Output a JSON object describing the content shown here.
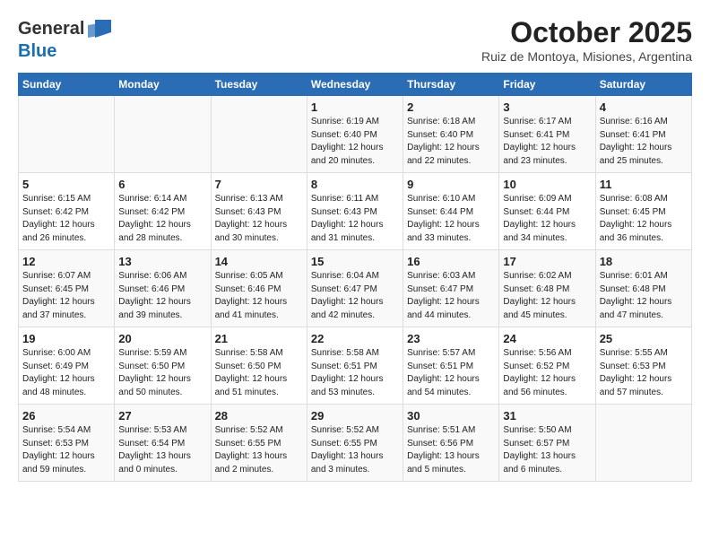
{
  "header": {
    "logo_line1": "General",
    "logo_line2": "Blue",
    "title": "October 2025",
    "subtitle": "Ruiz de Montoya, Misiones, Argentina"
  },
  "days_of_week": [
    "Sunday",
    "Monday",
    "Tuesday",
    "Wednesday",
    "Thursday",
    "Friday",
    "Saturday"
  ],
  "weeks": [
    [
      {
        "day": "",
        "info": ""
      },
      {
        "day": "",
        "info": ""
      },
      {
        "day": "",
        "info": ""
      },
      {
        "day": "1",
        "info": "Sunrise: 6:19 AM\nSunset: 6:40 PM\nDaylight: 12 hours and 20 minutes."
      },
      {
        "day": "2",
        "info": "Sunrise: 6:18 AM\nSunset: 6:40 PM\nDaylight: 12 hours and 22 minutes."
      },
      {
        "day": "3",
        "info": "Sunrise: 6:17 AM\nSunset: 6:41 PM\nDaylight: 12 hours and 23 minutes."
      },
      {
        "day": "4",
        "info": "Sunrise: 6:16 AM\nSunset: 6:41 PM\nDaylight: 12 hours and 25 minutes."
      }
    ],
    [
      {
        "day": "5",
        "info": "Sunrise: 6:15 AM\nSunset: 6:42 PM\nDaylight: 12 hours and 26 minutes."
      },
      {
        "day": "6",
        "info": "Sunrise: 6:14 AM\nSunset: 6:42 PM\nDaylight: 12 hours and 28 minutes."
      },
      {
        "day": "7",
        "info": "Sunrise: 6:13 AM\nSunset: 6:43 PM\nDaylight: 12 hours and 30 minutes."
      },
      {
        "day": "8",
        "info": "Sunrise: 6:11 AM\nSunset: 6:43 PM\nDaylight: 12 hours and 31 minutes."
      },
      {
        "day": "9",
        "info": "Sunrise: 6:10 AM\nSunset: 6:44 PM\nDaylight: 12 hours and 33 minutes."
      },
      {
        "day": "10",
        "info": "Sunrise: 6:09 AM\nSunset: 6:44 PM\nDaylight: 12 hours and 34 minutes."
      },
      {
        "day": "11",
        "info": "Sunrise: 6:08 AM\nSunset: 6:45 PM\nDaylight: 12 hours and 36 minutes."
      }
    ],
    [
      {
        "day": "12",
        "info": "Sunrise: 6:07 AM\nSunset: 6:45 PM\nDaylight: 12 hours and 37 minutes."
      },
      {
        "day": "13",
        "info": "Sunrise: 6:06 AM\nSunset: 6:46 PM\nDaylight: 12 hours and 39 minutes."
      },
      {
        "day": "14",
        "info": "Sunrise: 6:05 AM\nSunset: 6:46 PM\nDaylight: 12 hours and 41 minutes."
      },
      {
        "day": "15",
        "info": "Sunrise: 6:04 AM\nSunset: 6:47 PM\nDaylight: 12 hours and 42 minutes."
      },
      {
        "day": "16",
        "info": "Sunrise: 6:03 AM\nSunset: 6:47 PM\nDaylight: 12 hours and 44 minutes."
      },
      {
        "day": "17",
        "info": "Sunrise: 6:02 AM\nSunset: 6:48 PM\nDaylight: 12 hours and 45 minutes."
      },
      {
        "day": "18",
        "info": "Sunrise: 6:01 AM\nSunset: 6:48 PM\nDaylight: 12 hours and 47 minutes."
      }
    ],
    [
      {
        "day": "19",
        "info": "Sunrise: 6:00 AM\nSunset: 6:49 PM\nDaylight: 12 hours and 48 minutes."
      },
      {
        "day": "20",
        "info": "Sunrise: 5:59 AM\nSunset: 6:50 PM\nDaylight: 12 hours and 50 minutes."
      },
      {
        "day": "21",
        "info": "Sunrise: 5:58 AM\nSunset: 6:50 PM\nDaylight: 12 hours and 51 minutes."
      },
      {
        "day": "22",
        "info": "Sunrise: 5:58 AM\nSunset: 6:51 PM\nDaylight: 12 hours and 53 minutes."
      },
      {
        "day": "23",
        "info": "Sunrise: 5:57 AM\nSunset: 6:51 PM\nDaylight: 12 hours and 54 minutes."
      },
      {
        "day": "24",
        "info": "Sunrise: 5:56 AM\nSunset: 6:52 PM\nDaylight: 12 hours and 56 minutes."
      },
      {
        "day": "25",
        "info": "Sunrise: 5:55 AM\nSunset: 6:53 PM\nDaylight: 12 hours and 57 minutes."
      }
    ],
    [
      {
        "day": "26",
        "info": "Sunrise: 5:54 AM\nSunset: 6:53 PM\nDaylight: 12 hours and 59 minutes."
      },
      {
        "day": "27",
        "info": "Sunrise: 5:53 AM\nSunset: 6:54 PM\nDaylight: 13 hours and 0 minutes."
      },
      {
        "day": "28",
        "info": "Sunrise: 5:52 AM\nSunset: 6:55 PM\nDaylight: 13 hours and 2 minutes."
      },
      {
        "day": "29",
        "info": "Sunrise: 5:52 AM\nSunset: 6:55 PM\nDaylight: 13 hours and 3 minutes."
      },
      {
        "day": "30",
        "info": "Sunrise: 5:51 AM\nSunset: 6:56 PM\nDaylight: 13 hours and 5 minutes."
      },
      {
        "day": "31",
        "info": "Sunrise: 5:50 AM\nSunset: 6:57 PM\nDaylight: 13 hours and 6 minutes."
      },
      {
        "day": "",
        "info": ""
      }
    ]
  ]
}
